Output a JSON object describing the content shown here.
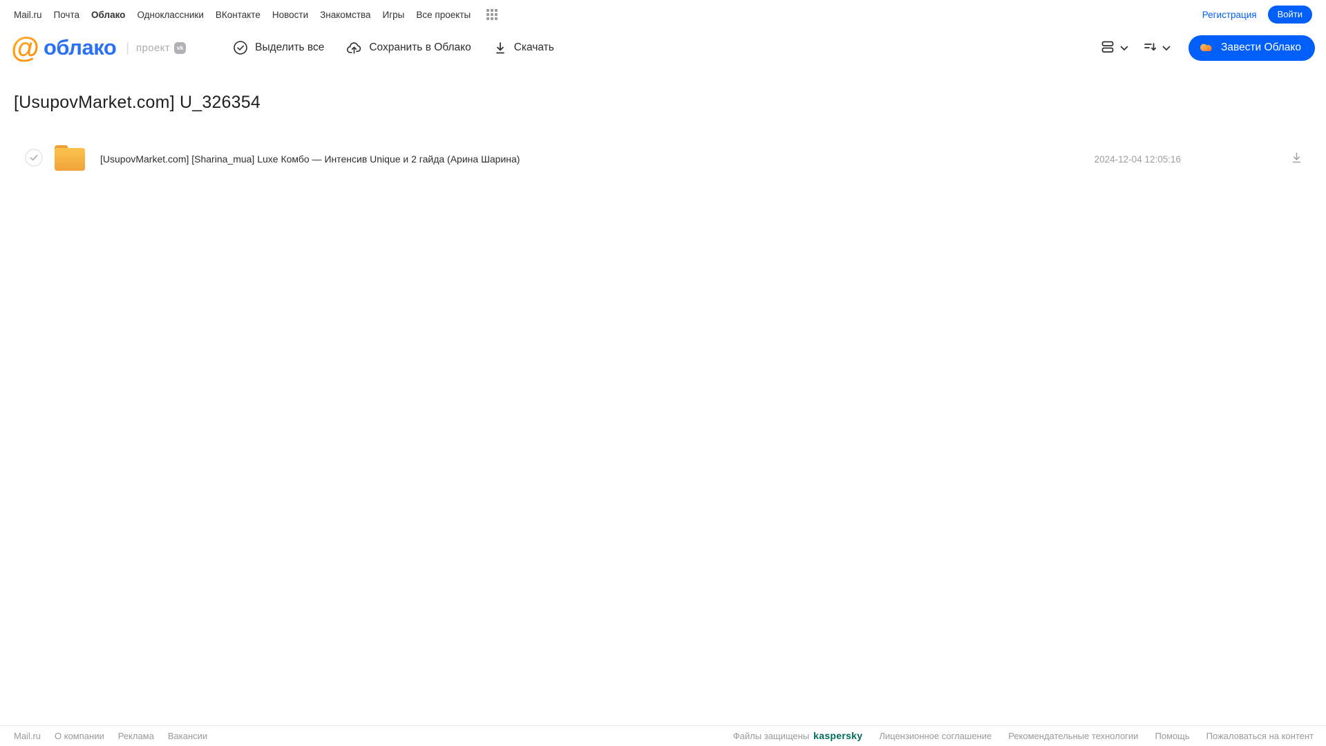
{
  "topnav": {
    "items": [
      "Mail.ru",
      "Почта",
      "Облако",
      "Одноклассники",
      "ВКонтакте",
      "Новости",
      "Знакомства",
      "Игры",
      "Все проекты"
    ],
    "active_item": "Облако",
    "registration_label": "Регистрация",
    "login_label": "Войти"
  },
  "header": {
    "logo": {
      "at": "@",
      "name": "облако",
      "divider": "|",
      "project": "проект",
      "vk_badge": "vk"
    },
    "toolbar": {
      "select_all": "Выделить все",
      "save_to_cloud": "Сохранить в Облако",
      "download": "Скачать"
    },
    "create_cloud_button": "Завести Облако"
  },
  "main": {
    "title": "[UsupovMarket.com] U_326354",
    "files": [
      {
        "type": "folder",
        "name": "[UsupovMarket.com] [Sharina_mua] Luxe Комбо — Интенсив Unique и 2 гайда (Арина Шарина)",
        "date": "2024-12-04 12:05:16"
      }
    ]
  },
  "footer": {
    "left_links": [
      "Mail.ru",
      "О компании",
      "Реклама",
      "Вакансии"
    ],
    "protected_text": "Файлы защищены",
    "kaspersky_label": "kaspersky",
    "right_links": [
      "Лицензионное соглашение",
      "Рекомендательные технологии",
      "Помощь",
      "Пожаловаться на контент"
    ]
  },
  "icons": {
    "apps_grid": "apps-grid-icon",
    "check_circle": "check-circle-icon",
    "cloud_upload": "cloud-upload-icon",
    "download": "download-icon",
    "list_view": "list-view-icon",
    "sort": "sort-icon",
    "chevron_down": "chevron-down-icon",
    "cloud_logo": "cloud-icon",
    "folder": "folder-icon",
    "vk_badge": "vk-badge-icon"
  },
  "colors": {
    "accent_blue": "#005FF9",
    "logo_blue": "#2B71F6",
    "logo_orange": "#FF9900",
    "folder_top": "#FBC34B",
    "folder_bottom": "#F1A33C",
    "kaspersky_green": "#006D5C",
    "gray_text": "#97999C"
  }
}
